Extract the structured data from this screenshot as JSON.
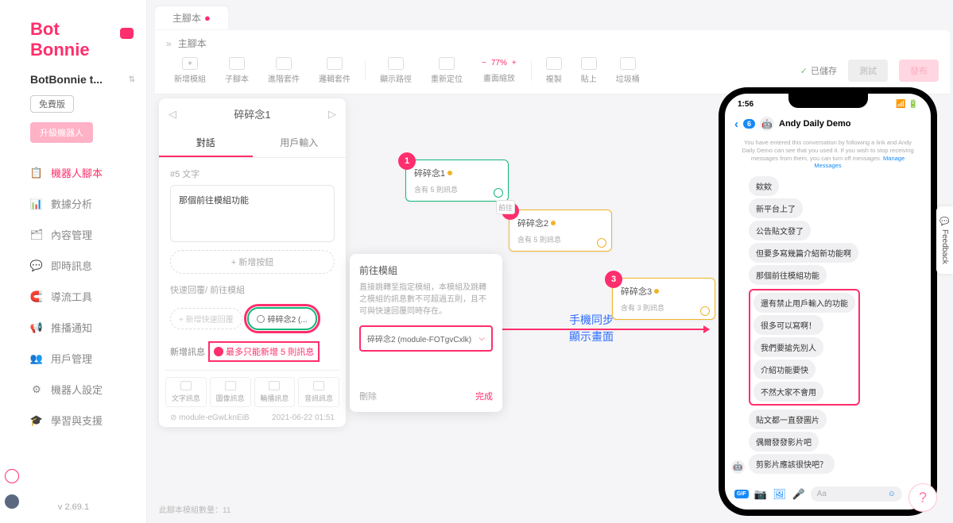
{
  "brand": "Bot Bonnie",
  "workspace": "BotBonnie t...",
  "free_tag": "免費版",
  "upgrade": "升級機器人",
  "nav": [
    {
      "icon": "📋",
      "label": "機器人腳本",
      "active": true
    },
    {
      "icon": "📊",
      "label": "數據分析"
    },
    {
      "icon": "🗂",
      "label": "內容管理"
    },
    {
      "icon": "💬",
      "label": "即時訊息"
    },
    {
      "icon": "🧲",
      "label": "導流工具"
    },
    {
      "icon": "📢",
      "label": "推播通知"
    },
    {
      "icon": "👥",
      "label": "用戶管理"
    },
    {
      "icon": "⚙",
      "label": "機器人設定"
    },
    {
      "icon": "🎓",
      "label": "學習與支援"
    }
  ],
  "version": "v 2.69.1",
  "tab_name": "主腳本",
  "breadcrumb": "主腳本",
  "tools": {
    "add": "新增模組",
    "sub": "子腳本",
    "adv": "進階套件",
    "logic": "邏輯套件",
    "path": "顯示路徑",
    "repos": "重新定位",
    "zoom_minus": "−",
    "zoom_val": "77%",
    "zoom_plus": "+",
    "zoom_label": "畫面縮放",
    "copy": "複製",
    "paste": "貼上",
    "trash": "垃圾桶"
  },
  "toolbar_right": {
    "saved": "已儲存",
    "test": "測試",
    "publish": "發布"
  },
  "editor": {
    "title": "碎碎念1",
    "tab_dialog": "對話",
    "tab_input": "用戶輸入",
    "section_num": "#5 文字",
    "text_content": "那個前往模組功能",
    "add_button": "+ 新增按鈕",
    "quick_label": "快速回覆/ 前往模組",
    "quick_disabled": "+ 新增快速回覆",
    "quick_active": "碎碎念2 (...",
    "new_msg": "新增訊息",
    "new_msg_warn": "最多只能新增 5 則訊息",
    "msg_types": [
      "文字訊息",
      "圖像訊息",
      "輪播訊息",
      "音訊訊息"
    ],
    "module_id": "module-eGwLknEiB",
    "timestamp": "2021-06-22 01:51"
  },
  "goto": {
    "title": "前往模組",
    "desc": "直接跳轉至指定模組，本模組及跳轉之模組的訊息數不可超過五則，且不可與快速回覆同時存在。",
    "selected": "碎碎念2 (module-FOTgvCxlk)",
    "delete": "刪除",
    "done": "完成"
  },
  "nodes": [
    {
      "badge": "1",
      "title": "碎碎念1",
      "sub": "含有 5 則訊息"
    },
    {
      "badge": "2",
      "title": "碎碎念2",
      "sub": "含有 5 則訊息"
    },
    {
      "badge": "3",
      "title": "碎碎念3",
      "sub": "含有 3 則訊息"
    }
  ],
  "flow_arrow_label": "前往",
  "sync_label_1": "手機同步",
  "sync_label_2": "顯示畫面",
  "phone": {
    "time": "1:56",
    "unread": "6",
    "bot_name": "Andy Daily Demo",
    "disclaimer": "You have entered this conversation by following a link and Andy Daily Demo can see that you used it. If you wish to stop receiving messages from them, you can turn off messages.",
    "disclaimer_link": "Manage Messages",
    "msgs_top": [
      "欸欸",
      "新平台上了",
      "公告貼文發了",
      "但要多寫幾篇介紹新功能啊",
      "那個前往模組功能"
    ],
    "msgs_box": [
      "還有禁止用戶輸入的功能",
      "很多可以寫啊！",
      "我們要搶先別人",
      "介紹功能要快",
      "不然大家不會用"
    ],
    "msgs_bottom": [
      "貼文都一直發圖片",
      "偶爾發發影片吧",
      "剪影片應該很快吧？"
    ],
    "input_placeholder": "Aa"
  },
  "feedback": "Feedback",
  "bottom_status": "此腳本模組數量：11"
}
